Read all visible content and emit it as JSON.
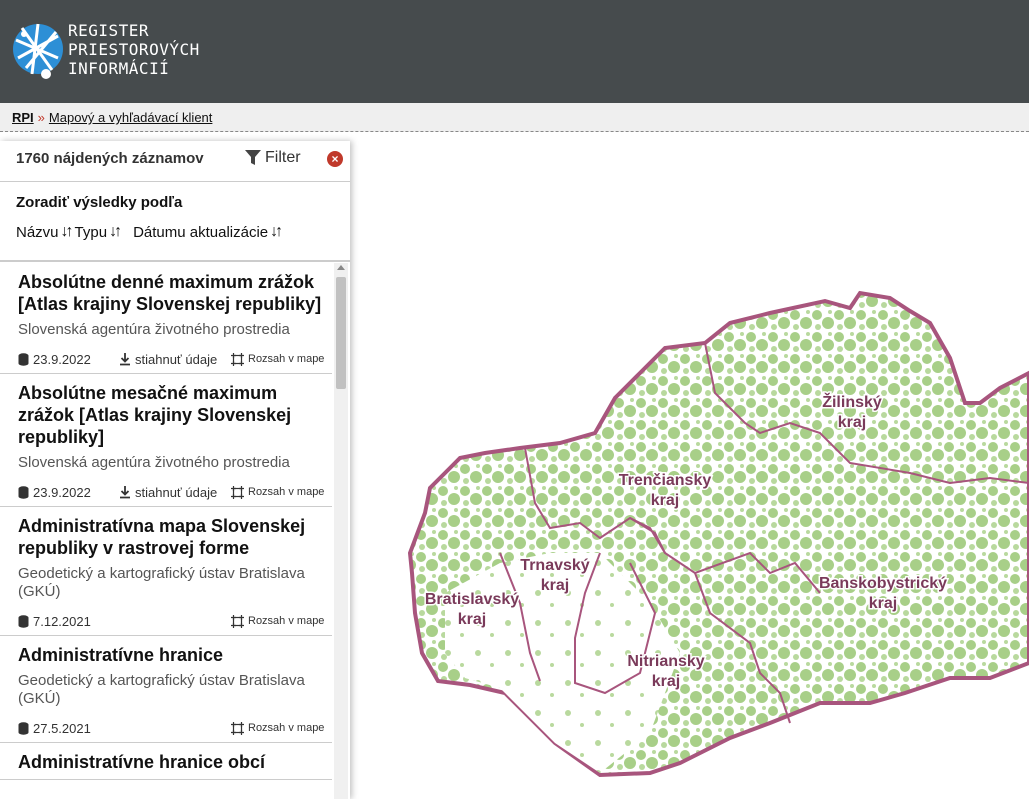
{
  "header": {
    "logo_lines": [
      "REGISTER",
      "PRIESTOROVÝCH",
      "INFORMÁCIÍ"
    ]
  },
  "breadcrumb": {
    "root": "RPI",
    "separator": "»",
    "current": "Mapový a vyhľadávací klient"
  },
  "results_panel": {
    "count_text": "1760 nájdených záznamov",
    "filter_label": "Filter",
    "close_icon": "close-icon",
    "sort_title": "Zoradiť výsledky podľa",
    "sort_options": [
      "Názvu",
      "Typu",
      "Dátumu aktualizácie"
    ],
    "sort_icon": "sort-arrows-icon"
  },
  "results": [
    {
      "title": "Absolútne denné maximum zrážok [Atlas krajiny Slovenskej republiky]",
      "org": "Slovenská agentúra životného prostredia",
      "date": "23.9.2022",
      "download": "stiahnuť údaje",
      "extent": "Rozsah v mape"
    },
    {
      "title": "Absolútne mesačné maximum zrážok [Atlas krajiny Slovenskej republiky]",
      "org": "Slovenská agentúra životného prostredia",
      "date": "23.9.2022",
      "download": "stiahnuť údaje",
      "extent": "Rozsah v mape"
    },
    {
      "title": "Administratívna mapa Slovenskej republiky v rastrovej forme",
      "org": "Geodetický a kartografický ústav Bratislava (GKÚ)",
      "date": "7.12.2021",
      "download": "",
      "extent": "Rozsah v mape"
    },
    {
      "title": "Administratívne hranice",
      "org": "Geodetický a kartografický ústav Bratislava (GKÚ)",
      "date": "27.5.2021",
      "download": "",
      "extent": "Rozsah v mape"
    },
    {
      "title": "Administratívne hranice obcí",
      "org": "",
      "date": "",
      "download": "",
      "extent": ""
    }
  ],
  "map": {
    "regions": [
      {
        "name": "Žilinský",
        "suffix": "kraj"
      },
      {
        "name": "Trenčiansky",
        "suffix": "kraj"
      },
      {
        "name": "Trnavský",
        "suffix": "kraj"
      },
      {
        "name": "Bratislavský",
        "suffix": "kraj"
      },
      {
        "name": "Nitriansky",
        "suffix": "kraj"
      },
      {
        "name": "Banskobystrický",
        "suffix": "kraj"
      }
    ],
    "colors": {
      "forest": "#a8cf88",
      "border": "#a8557d",
      "label": "#7a3a5a"
    }
  }
}
